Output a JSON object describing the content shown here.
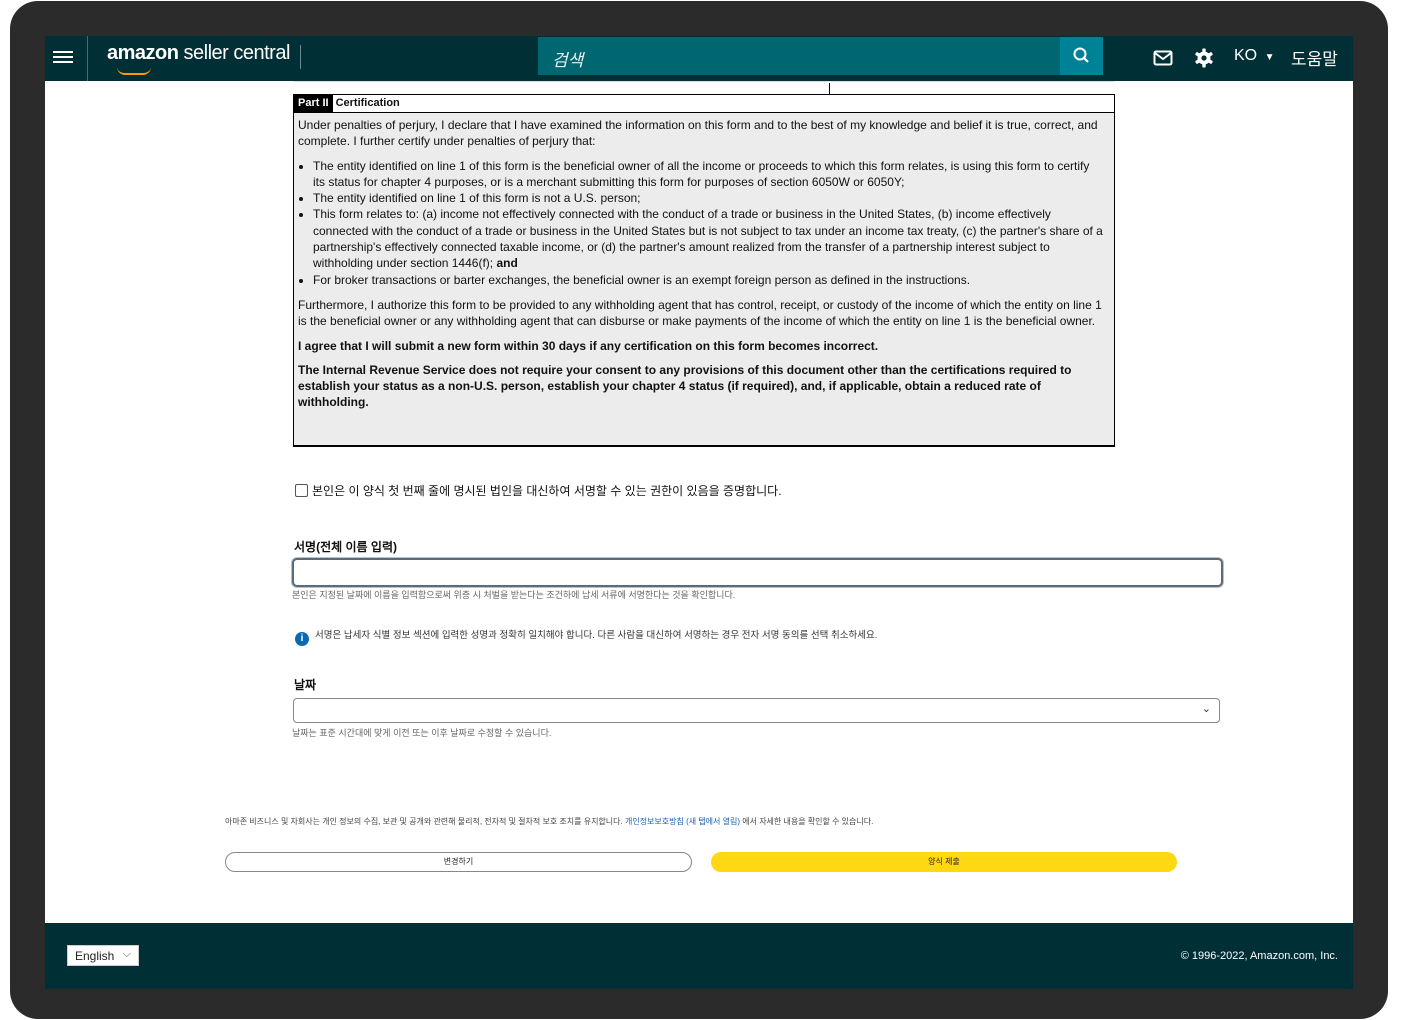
{
  "header": {
    "logo_brand": "amazon",
    "logo_rest": " seller central",
    "search_placeholder": "검색",
    "language": "KO",
    "help": "도움말"
  },
  "form": {
    "part_tag": "Part II",
    "part_title": "Certification",
    "intro": "Under penalties of perjury, I declare that I have examined the information on this form and to the best of my knowledge and belief it is true, correct, and complete. I further certify under penalties of perjury that:",
    "bullets": [
      "The entity identified on line 1 of this form is the beneficial owner of all the income or proceeds to which this form relates, is using this form to certify its status for chapter 4 purposes, or is a merchant submitting this form for purposes of section 6050W or 6050Y;",
      "The entity identified on line 1 of this form is not a U.S. person;",
      "This form relates to: (a) income not effectively connected with the conduct of a trade or business in the United States, (b) income effectively connected with the conduct of a trade or business in the United States but is not subject to tax under an income tax treaty, (c) the partner's share of a partnership's effectively connected taxable income, or (d) the partner's amount realized from the transfer of a partnership interest subject to withholding under section 1446(f);",
      "For broker transactions or barter exchanges, the beneficial owner is an exempt foreign person as defined in the instructions."
    ],
    "bullet3_suffix": "and",
    "furthermore": "Furthermore, I authorize this form to be provided to any withholding agent that has control, receipt, or custody of the income of which the entity on line 1 is the beneficial owner or any withholding agent that can disburse or make payments of the income of which the entity on line 1 is the beneficial owner.",
    "agree": "I agree that I will submit a new form within 30 days if any certification on this form becomes incorrect.",
    "irs": "The Internal Revenue Service does not require your consent to any provisions of this document other than the certifications required to establish your status as a non-U.S. person, establish your chapter 4 status (if required), and, if applicable, obtain a reduced rate of withholding."
  },
  "authority_checkbox": "본인은 이 양식 첫 번째 줄에 명시된 법인을 대신하여 서명할 수 있는 권한이 있음을 증명합니다.",
  "signature": {
    "label": "서명(전체 이름 입력)",
    "value": "",
    "hint": "본인은 지정된 날짜에 이름을 입력함으로써 위증 시 처벌을 받는다는 조건하에 납세 서류에 서명한다는 것을 확인합니다."
  },
  "info_message": "서명은 납세자 식별 정보 섹션에 입력한 성명과 정확히 일치해야 합니다. 다른 사람을 대신하여 서명하는 경우 전자 서명 동의를 선택 취소하세요.",
  "date": {
    "label": "날짜",
    "value": "",
    "hint": "날짜는 표준 시간대에 맞게 이전 또는 이후 날짜로 수정할 수 있습니다."
  },
  "privacy": {
    "before": "아마존 비즈니스 및 자회사는 개인 정보의 수집, 보관 및 공개와 관련해 물리적, 전자적 및 절차적 보호 조치를 유지합니다.",
    "link": "개인정보보호방침 (새 탭에서 열림)",
    "after": "에서 자세한 내용을 확인할 수 있습니다."
  },
  "buttons": {
    "change": "변경하기",
    "submit": "양식 제출"
  },
  "footer": {
    "language": "English",
    "copyright": "© 1996-2022, Amazon.com, Inc."
  },
  "colors": {
    "header_bg": "#002f36",
    "search_bg": "#00666f",
    "search_button": "#008296",
    "submit_button": "#ffd814",
    "info_icon": "#0a69b3"
  }
}
